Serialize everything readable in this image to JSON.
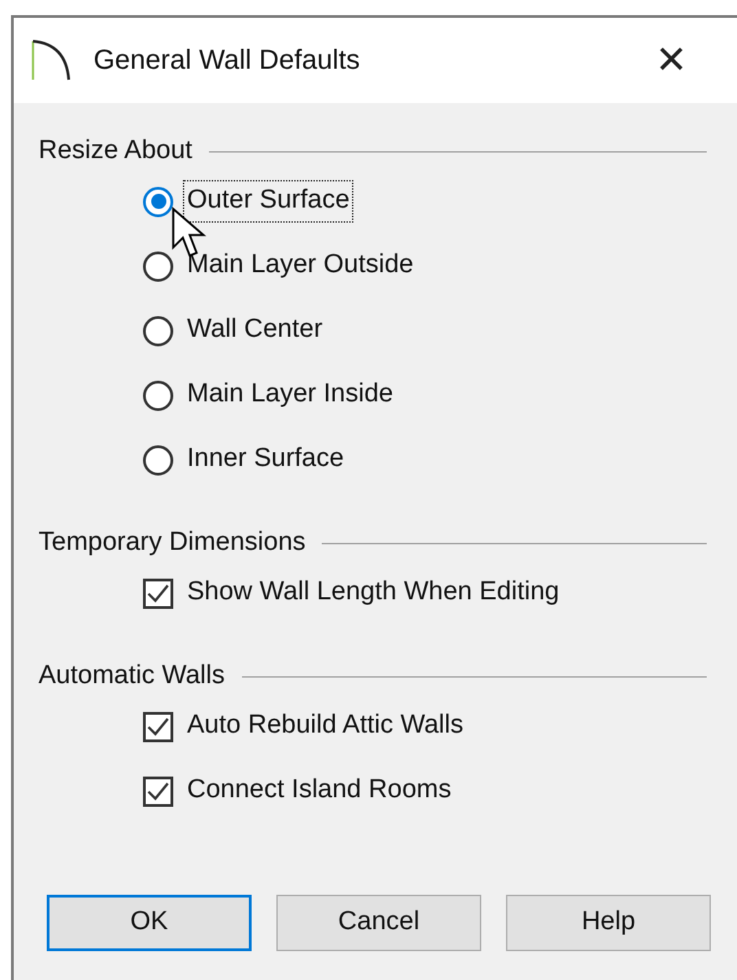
{
  "window": {
    "title": "General Wall Defaults",
    "close": "✕"
  },
  "sections": [
    {
      "title": "Resize About",
      "items": [
        {
          "kind": "radio",
          "label": "Outer Surface",
          "selected": true,
          "focused": true
        },
        {
          "kind": "radio",
          "label": "Main Layer Outside",
          "selected": false,
          "focused": false
        },
        {
          "kind": "radio",
          "label": "Wall Center",
          "selected": false,
          "focused": false
        },
        {
          "kind": "radio",
          "label": "Main Layer Inside",
          "selected": false,
          "focused": false
        },
        {
          "kind": "radio",
          "label": "Inner Surface",
          "selected": false,
          "focused": false
        }
      ]
    },
    {
      "title": "Temporary Dimensions",
      "items": [
        {
          "kind": "checkbox",
          "label": "Show Wall Length When Editing",
          "checked": true
        }
      ]
    },
    {
      "title": "Automatic Walls",
      "items": [
        {
          "kind": "checkbox",
          "label": "Auto Rebuild Attic Walls",
          "checked": true
        },
        {
          "kind": "checkbox",
          "label": "Connect Island Rooms",
          "checked": true
        }
      ]
    }
  ],
  "buttons": [
    {
      "label": "OK",
      "default": true
    },
    {
      "label": "Cancel",
      "default": false
    },
    {
      "label": "Help",
      "default": false
    }
  ]
}
